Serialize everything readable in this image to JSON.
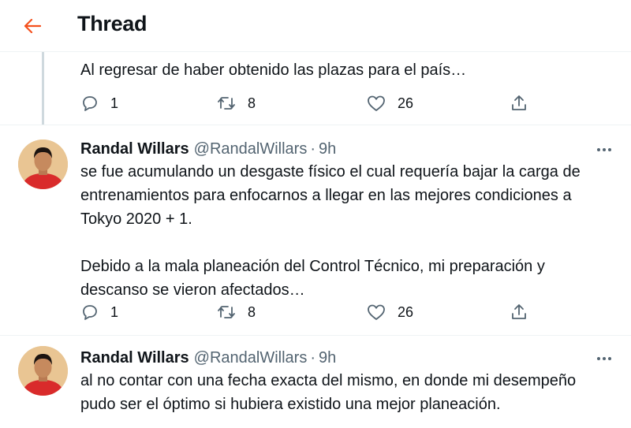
{
  "header": {
    "title": "Thread",
    "back_icon": "arrow-left-icon",
    "accent": "#f4511e"
  },
  "tweets": [
    {
      "text": "Al regresar de haber obtenido las plazas para el país…",
      "actions": {
        "replies": "1",
        "retweets": "8",
        "likes": "26"
      }
    },
    {
      "author": {
        "name": "Randal Willars",
        "handle": "@RandalWillars",
        "time": "9h"
      },
      "text_lines": [
        "se fue acumulando un desgaste físico el cual requería bajar la carga de",
        "entrenamientos para enfocarnos a llegar en las mejores condiciones a",
        "Tokyo 2020 + 1.",
        "",
        "Debido a la mala planeación del Control Técnico, mi preparación y",
        "descanso se vieron afectados…"
      ],
      "actions": {
        "replies": "1",
        "retweets": "8",
        "likes": "26"
      }
    },
    {
      "author": {
        "name": "Randal Willars",
        "handle": "@RandalWillars",
        "time": "9h"
      },
      "text_lines": [
        "al no contar con una fecha exacta del mismo, en donde mi desempeño",
        "pudo ser el óptimo si hubiera existido una mejor planeación."
      ]
    }
  ],
  "separator": "·",
  "icons": [
    "reply-icon",
    "retweet-icon",
    "like-icon",
    "share-icon",
    "more-icon"
  ]
}
